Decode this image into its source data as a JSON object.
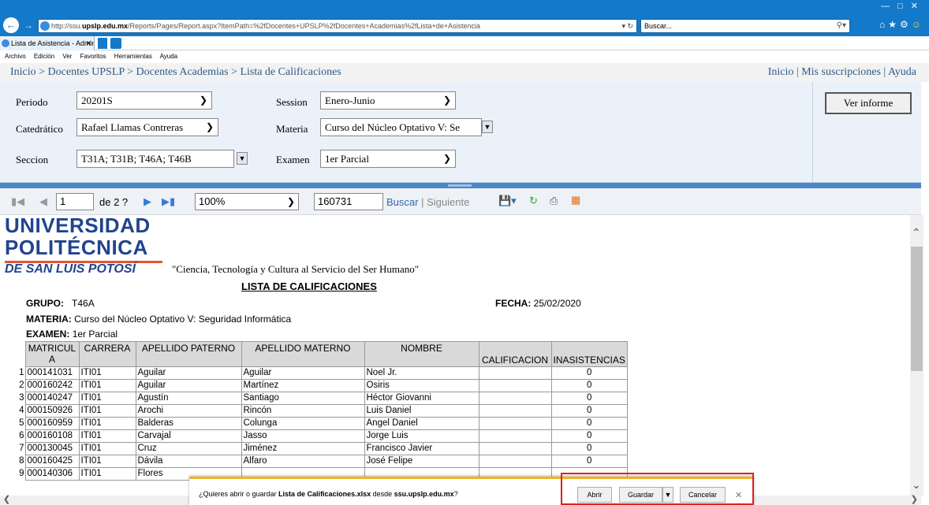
{
  "browser": {
    "address_url": "http://ssu.upslp.edu.mx/Reports/Pages/Report.aspx?ItemPath=%2fDocentes+UPSLP%2fDocentes+Academias%2fLista+de+Asistencia",
    "address_scheme": "http://ssu.",
    "address_host": "upslp.edu.mx",
    "address_path": "/Reports/Pages/Report.aspx?ItemPath=%2fDocentes+UPSLP%2fDocentes+Academias%2fLista+de+Asistencia",
    "search_placeholder": "Buscar...",
    "tab_title": "Lista de Asistencia - Admini...",
    "menu": [
      "Archivo",
      "Edición",
      "Ver",
      "Favoritos",
      "Herramientas",
      "Ayuda"
    ]
  },
  "breadcrumb": "Inicio > Docentes UPSLP > Docentes Academias > Lista de Calificaciones",
  "top_links": "Inicio | Mis suscripciones | Ayuda",
  "params": {
    "periodo_label": "Periodo",
    "periodo_value": "20201S",
    "session_label": "Session",
    "session_value": "Enero-Junio",
    "catedratico_label": "Catedrático",
    "catedratico_value": "Rafael Llamas Contreras",
    "materia_label": "Materia",
    "materia_value": "Curso del Núcleo Optativo V: Se",
    "seccion_label": "Seccion",
    "seccion_value": "T31A; T31B; T46A; T46B",
    "examen_label": "Examen",
    "examen_value": "1er Parcial",
    "run_button": "Ver informe"
  },
  "toolbar": {
    "page_value": "1",
    "page_of": "de 2 ?",
    "zoom": "100%",
    "search_value": "160731",
    "find_label": "Buscar",
    "separator": "|",
    "next_label": "Siguiente"
  },
  "report": {
    "logo_line1": "UNIVERSIDAD",
    "logo_line2": "POLITÉCNICA",
    "logo_line3": "DE SAN LUIS POTOSÍ",
    "motto": "\"Ciencia, Tecnología y Cultura al Servicio del Ser Humano\"",
    "title": "LISTA DE CALIFICACIONES",
    "grupo_label": "GRUPO:",
    "grupo_value": "T46A",
    "fecha_label": "FECHA:",
    "fecha_value": "25/02/2020",
    "materia_label": "MATERIA:",
    "materia_value": "Curso del Núcleo Optativo V: Seguridad Informática",
    "examen_label": "EXAMEN:",
    "examen_value": "1er Parcial",
    "columns": [
      "MATRICUL A",
      "CARRERA",
      "APELLIDO PATERNO",
      "APELLIDO MATERNO",
      "NOMBRE",
      "CALIFICACION",
      "INASISTENCIAS"
    ],
    "rows": [
      [
        "1",
        "000141031",
        "ITI01",
        "Aguilar",
        "Aguilar",
        "Noel Jr.",
        "",
        "0"
      ],
      [
        "2",
        "000160242",
        "ITI01",
        "Aguilar",
        "Martínez",
        "Osiris",
        "",
        "0"
      ],
      [
        "3",
        "000140247",
        "ITI01",
        "Agustín",
        "Santiago",
        "Héctor Giovanni",
        "",
        "0"
      ],
      [
        "4",
        "000150926",
        "ITI01",
        "Arochi",
        "Rincón",
        "Luis Daniel",
        "",
        "0"
      ],
      [
        "5",
        "000160959",
        "ITI01",
        "Balderas",
        "Colunga",
        "Angel Daniel",
        "",
        "0"
      ],
      [
        "6",
        "000160108",
        "ITI01",
        "Carvajal",
        "Jasso",
        "Jorge Luis",
        "",
        "0"
      ],
      [
        "7",
        "000130045",
        "ITI01",
        "Cruz",
        "Jiménez",
        "Francisco Javier",
        "",
        "0"
      ],
      [
        "8",
        "000160425",
        "ITI01",
        "Dávila",
        "Alfaro",
        "José Felipe",
        "",
        "0"
      ],
      [
        "9",
        "000140306",
        "ITI01",
        "Flores",
        "",
        "",
        "",
        ""
      ]
    ]
  },
  "download_bar": {
    "prefix": "¿Quieres abrir o guardar ",
    "filename": "Lista de Calificaciones.xlsx",
    "middle": " desde ",
    "source": "ssu.upslp.edu.mx",
    "suffix": "?",
    "open_label": "Abrir",
    "save_label": "Guardar",
    "cancel_label": "Cancelar"
  },
  "colors": {
    "titlebar": "#1479c8",
    "logo_blue": "#21448e",
    "logo_orange": "#e8542d",
    "highlight_red": "#e0201e",
    "notif_accent": "#f0b324"
  }
}
